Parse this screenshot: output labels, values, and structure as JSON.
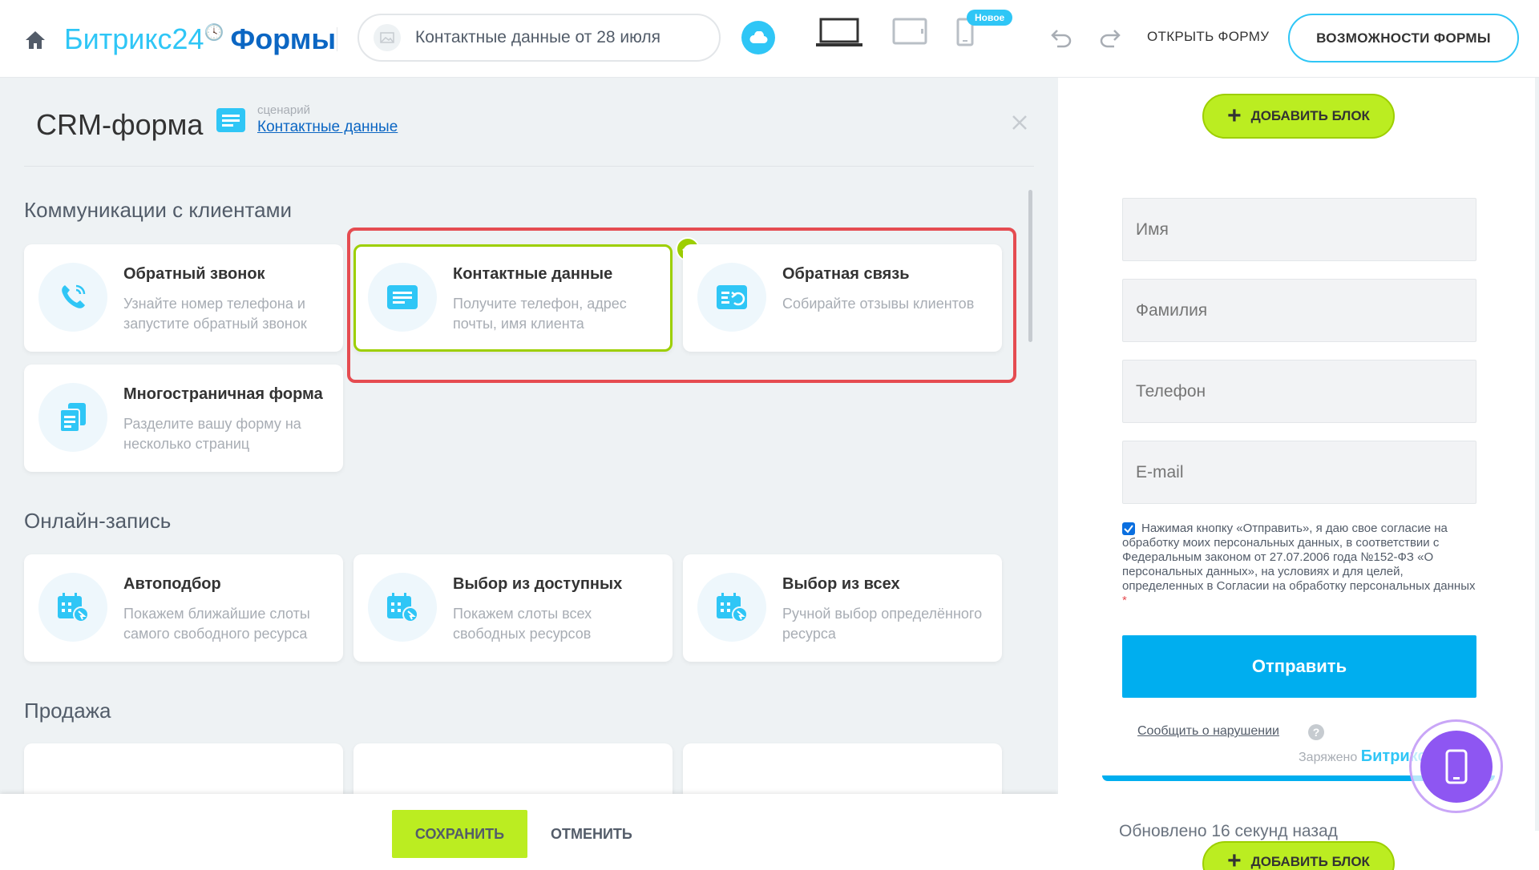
{
  "header": {
    "brand_b24": "Битрикс24",
    "brand_forms": "Формы",
    "form_title": "Контактные данные от 28 июля",
    "new_badge": "Новое",
    "open_form": "ОТКРЫТЬ ФОРМУ",
    "features_button": "ВОЗМОЖНОСТИ ФОРМЫ"
  },
  "panel": {
    "title": "CRM-форма",
    "scenario_label": "сценарий",
    "scenario_value": "Контактные данные"
  },
  "sections": [
    {
      "title": "Коммуникации с клиентами",
      "cards": [
        {
          "title": "Обратный звонок",
          "desc": "Узнайте номер телефона и запустите обратный звонок",
          "icon": "phone-icon"
        },
        {
          "title": "Контактные данные",
          "desc": "Получите телефон, адрес почты, имя клиента",
          "icon": "form-icon",
          "selected": true
        },
        {
          "title": "Обратная связь",
          "desc": "Собирайте отзывы клиентов",
          "icon": "feedback-icon"
        },
        {
          "title": "Многостраничная форма",
          "desc": "Разделите вашу форму на несколько страниц",
          "icon": "pages-icon"
        }
      ]
    },
    {
      "title": "Онлайн-запись",
      "cards": [
        {
          "title": "Автоподбор",
          "desc": "Покажем ближайшие слоты самого свободного ресурса",
          "icon": "calendar-icon"
        },
        {
          "title": "Выбор из доступных",
          "desc": "Покажем слоты всех свободных ресурсов",
          "icon": "calendar-icon"
        },
        {
          "title": "Выбор из всех",
          "desc": "Ручной выбор определённого ресурса",
          "icon": "calendar-icon"
        }
      ]
    },
    {
      "title": "Продажа",
      "cards": []
    }
  ],
  "footer": {
    "save": "СОХРАНИТЬ",
    "cancel": "ОТМЕНИТЬ"
  },
  "preview": {
    "add_block": "ДОБАВИТЬ БЛОК",
    "fields": [
      {
        "placeholder": "Имя"
      },
      {
        "placeholder": "Фамилия"
      },
      {
        "placeholder": "Телефон"
      },
      {
        "placeholder": "E-mail"
      }
    ],
    "consent": "Нажимая кнопку «Отправить», я даю свое согласие на обработку моих персональных данных, в соответствии с Федеральным законом от 27.07.2006 года №152-ФЗ «О персональных данных», на условиях и для целей, определенных в Согласии на обработку персональных данных",
    "consent_required": "*",
    "submit": "Отправить",
    "report": "Сообщить о нарушении",
    "help": "?",
    "powered_label": "Заряжено",
    "powered_brand": "Битрикс",
    "updated": "Обновлено 16 секунд назад"
  },
  "colors": {
    "accent_blue": "#2fc6f6",
    "brand_dark_blue": "#0b66c3",
    "green": "#bbed21",
    "selection_red": "#e54c51",
    "submit_blue": "#00aeef"
  }
}
